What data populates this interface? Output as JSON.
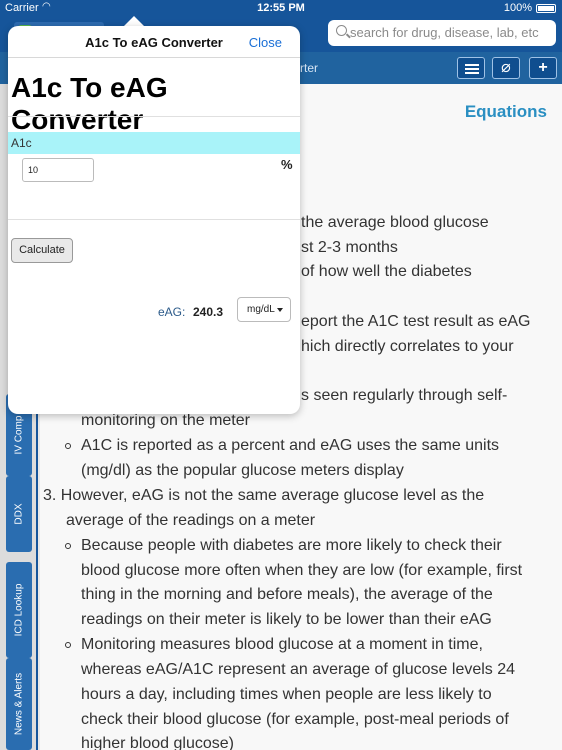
{
  "status_bar": {
    "carrier": "Carrier",
    "time": "12:55 PM",
    "battery": "100%"
  },
  "header": {
    "search_placeholder": "search for drug, disease, lab, etc",
    "toolbar_title": "rter"
  },
  "side_tabs": [
    "IV Comp",
    "DDX",
    "ICD Lookup",
    "News & Alerts"
  ],
  "content": {
    "equations_link": "Equations",
    "lines": [
      "the average blood glucose",
      "st 2-3 months",
      "of how well the diabetes",
      "eport the A1C test result as eAG",
      "hich directly correlates to your",
      "s seen regularly through self-",
      "monitoring on the meter",
      "A1C is reported as a percent and eAG uses the same units",
      "(mg/dl) as the popular glucose meters display",
      "3.  However, eAG is not the same average glucose level as the",
      "average of the readings on a meter",
      "Because people with diabetes are more likely to check their",
      "blood glucose more often when they are low (for example, first",
      "thing in the morning and before meals), the average of the",
      "readings on their meter is likely to be lower than their eAG",
      "Monitoring measures blood glucose at a moment in time,",
      "whereas eAG/A1C represent an average of glucose levels 24",
      "hours a day, including times when people are less likely to",
      "check their blood glucose (for example, post-meal periods of",
      "higher blood glucose)"
    ]
  },
  "popover": {
    "title": "A1c To eAG Converter",
    "close_label": "Close",
    "heading": "A1c To eAG Converter",
    "a1c_label": "A1c",
    "a1c_value": "10",
    "percent_label": "%",
    "calculate_label": "Calculate",
    "eag_label": "eAG:",
    "eag_value": "240.3",
    "unit_selected": "mg/dL"
  },
  "colors": {
    "header_blue": "#16559a",
    "toolbar_blue": "#20639f",
    "link_blue": "#2a8fc2",
    "a1c_highlight": "#a9f3f9",
    "close_blue": "#1a6fd6"
  }
}
